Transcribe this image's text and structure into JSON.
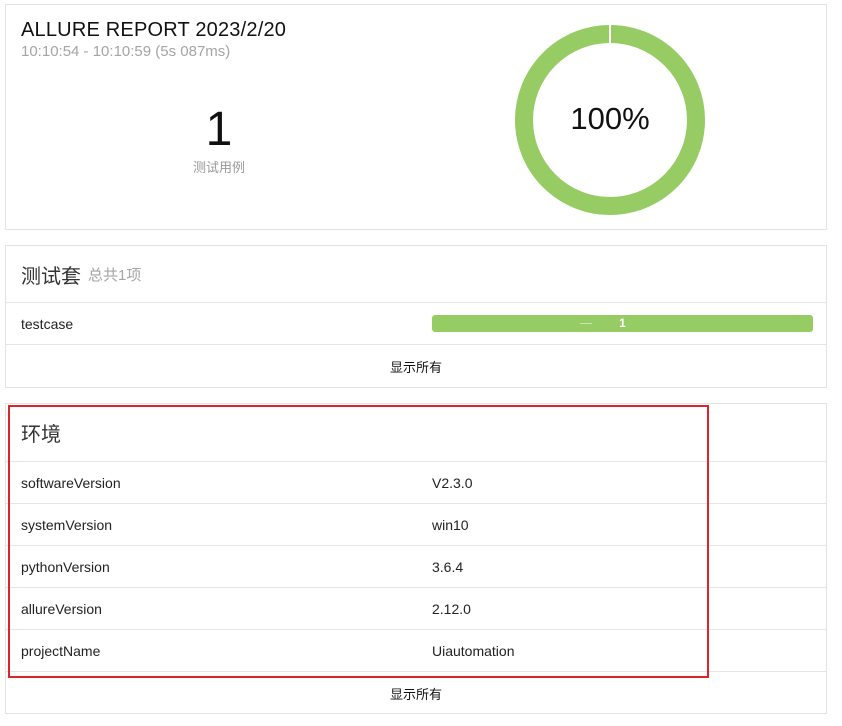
{
  "summary": {
    "title": "ALLURE REPORT 2023/2/20",
    "time_range": "10:10:54 - 10:10:59 (5s 087ms)",
    "test_count": "1",
    "test_count_label": "测试用例",
    "pass_percent": "100%",
    "pass_fraction": 1.0,
    "colors": {
      "passed": "#97cc64",
      "track": "#e8f3dc"
    }
  },
  "suites": {
    "title": "测试套",
    "subtitle": "总共1项",
    "items": [
      {
        "name": "testcase",
        "count": "1"
      }
    ],
    "show_all": "显示所有"
  },
  "environment": {
    "title": "环境",
    "rows": [
      {
        "key": "softwareVersion",
        "value": "V2.3.0"
      },
      {
        "key": "systemVersion",
        "value": "win10"
      },
      {
        "key": "pythonVersion",
        "value": "3.6.4"
      },
      {
        "key": "allureVersion",
        "value": "2.12.0"
      },
      {
        "key": "projectName",
        "value": "Uiautomation"
      }
    ],
    "show_all": "显示所有",
    "highlight_color": "#d9262b"
  }
}
